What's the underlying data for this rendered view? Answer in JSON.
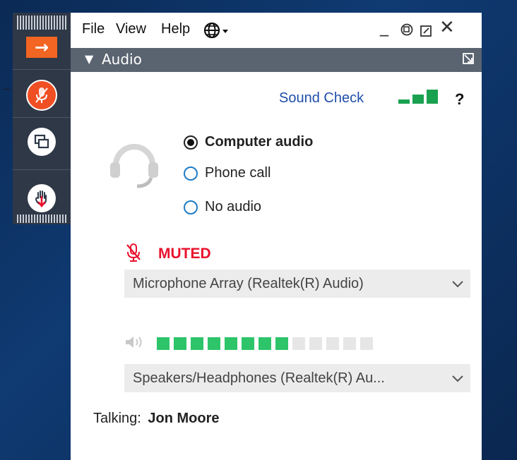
{
  "window": {
    "menu": [
      "File",
      "View",
      "Help"
    ],
    "controls": {
      "minimize": "_",
      "close": "✕"
    }
  },
  "dock": {
    "arrow_icon": "→",
    "buttons": [
      "expand-arrow-icon",
      "mic-muted-icon",
      "screen-share-icon",
      "raise-hand-icon"
    ]
  },
  "audio": {
    "header_title": "Audio",
    "sound_check_label": "Sound Check",
    "help_label": "?",
    "options": [
      {
        "label": "Computer audio",
        "selected": true
      },
      {
        "label": "Phone call",
        "selected": false
      },
      {
        "label": "No audio",
        "selected": false
      }
    ],
    "mic_status": "MUTED",
    "microphone_device": "Microphone Array (Realtek(R) Audio)",
    "speaker_device": "Speakers/Headphones  (Realtek(R)  Au...",
    "speaker_level": {
      "lit": 8,
      "total": 13
    },
    "talking_label": "Talking:",
    "talking_name": "Jon Moore"
  },
  "colors": {
    "accent_orange": "#f26522",
    "mute_red": "#e8112d",
    "link_blue": "#1f4fa8",
    "meter_green": "#2dc46a",
    "meter_off": "#e6e6e6",
    "header_gray": "#5a6370"
  }
}
